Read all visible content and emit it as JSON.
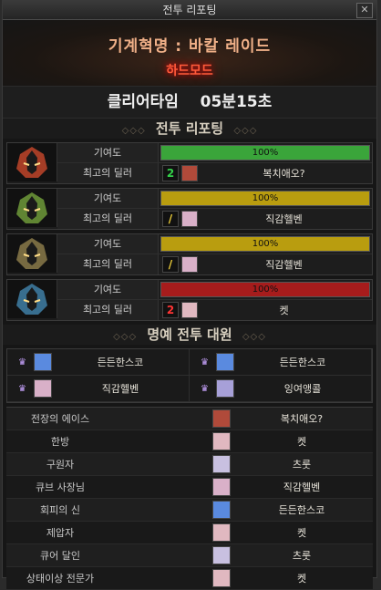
{
  "window": {
    "title": "전투 리포팅",
    "close_label": "✕"
  },
  "header": {
    "raid_name": "기계혁명 : 바칼 레이드",
    "mode": "하드모드"
  },
  "clear": {
    "label": "클리어타임",
    "time": "05분15초"
  },
  "report_section": {
    "title": "전투 리포팅"
  },
  "players": [
    {
      "contribution_label": "기여도",
      "contribution_text": "100%",
      "contribution_pct": 100,
      "bar_color": "#3aa53a",
      "dealer_label": "최고의 딜러",
      "dealer_class_glyph": "2",
      "dealer_class_color": "#34d24a",
      "dealer_face_color": "#b04a3a",
      "dealer_name": "복치애오?",
      "avatar_color": "#c0452a"
    },
    {
      "contribution_label": "기여도",
      "contribution_text": "100%",
      "contribution_pct": 100,
      "bar_color": "#b99d0f",
      "dealer_label": "최고의 딜러",
      "dealer_class_glyph": "/",
      "dealer_class_color": "#f2d23a",
      "dealer_face_color": "#d9b0c8",
      "dealer_name": "직감헬벤",
      "avatar_color": "#6f9a3a"
    },
    {
      "contribution_label": "기여도",
      "contribution_text": "100%",
      "contribution_pct": 100,
      "bar_color": "#b99d0f",
      "dealer_label": "최고의 딜러",
      "dealer_class_glyph": "/",
      "dealer_class_color": "#f2d23a",
      "dealer_face_color": "#d9b0c8",
      "dealer_name": "직감헬벤",
      "avatar_color": "#8a7a4a"
    },
    {
      "contribution_label": "기여도",
      "contribution_text": "100%",
      "contribution_pct": 100,
      "bar_color": "#a61c1c",
      "dealer_label": "최고의 딜러",
      "dealer_class_glyph": "2",
      "dealer_class_color": "#ff3434",
      "dealer_face_color": "#e0b8c0",
      "dealer_name": "켓",
      "avatar_color": "#3f7fa6"
    }
  ],
  "honor_section": {
    "title": "명예 전투 대원"
  },
  "honor": [
    {
      "name": "든든한스코",
      "face_color": "#5a8adf"
    },
    {
      "name": "든든한스코",
      "face_color": "#5a8adf"
    },
    {
      "name": "직감헬벤",
      "face_color": "#d9b0c8"
    },
    {
      "name": "잉여앵콜",
      "face_color": "#a7a0d8"
    }
  ],
  "awards": [
    {
      "title": "전장의 에이스",
      "name": "복치애오?",
      "face_color": "#b04a3a"
    },
    {
      "title": "한방",
      "name": "켓",
      "face_color": "#e0b8c0"
    },
    {
      "title": "구원자",
      "name": "츠룻",
      "face_color": "#c8c0e0"
    },
    {
      "title": "큐브 사장님",
      "name": "직감헬벤",
      "face_color": "#d9b0c8"
    },
    {
      "title": "회피의 신",
      "name": "든든한스코",
      "face_color": "#5a8adf"
    },
    {
      "title": "제압자",
      "name": "켓",
      "face_color": "#e0b8c0"
    },
    {
      "title": "큐어 달인",
      "name": "츠룻",
      "face_color": "#c8c0e0"
    },
    {
      "title": "상태이상 전문가",
      "name": "켓",
      "face_color": "#e0b8c0"
    }
  ]
}
